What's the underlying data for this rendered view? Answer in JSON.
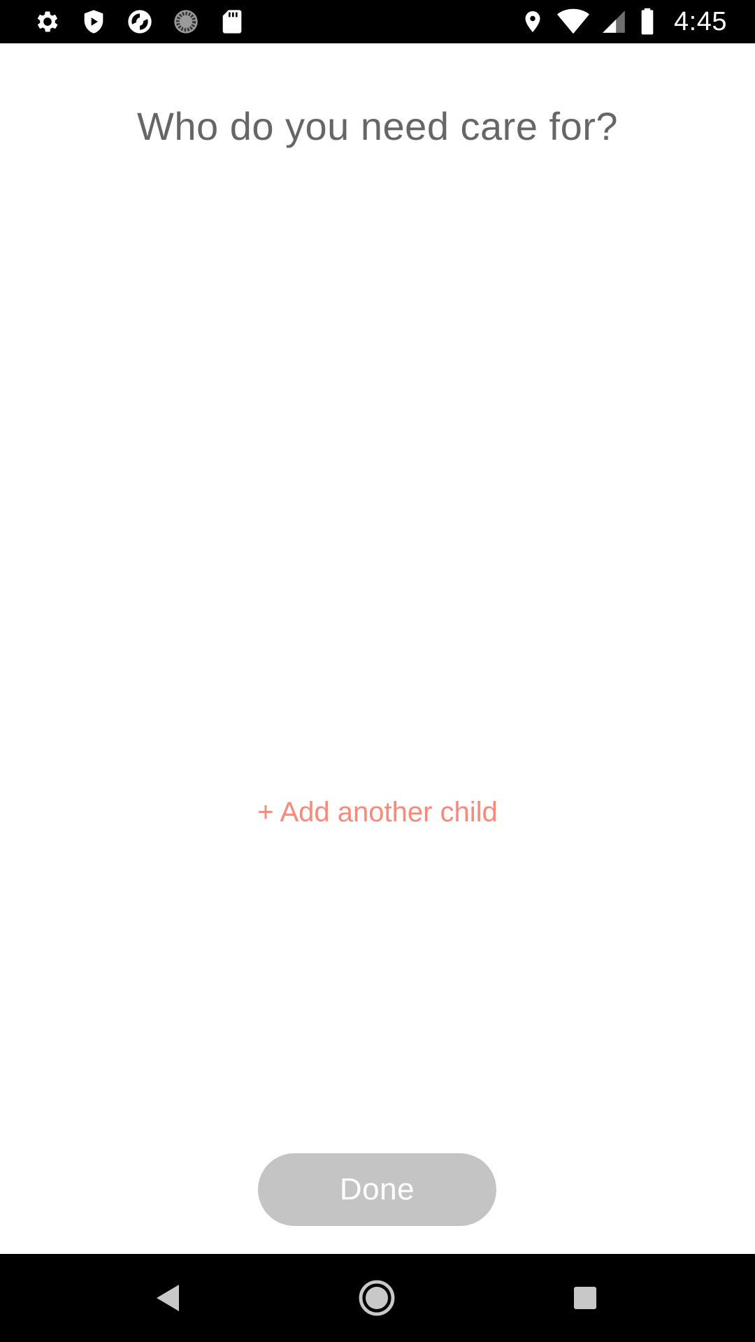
{
  "status_bar": {
    "time": "4:45",
    "left_icons": [
      "settings-gear-icon",
      "shield-icon",
      "sync-app-icon",
      "loading-circle-icon",
      "sd-card-icon"
    ],
    "right_icons": [
      "location-pin-icon",
      "wifi-icon",
      "cell-signal-icon",
      "battery-icon"
    ]
  },
  "main": {
    "title": "Who do you need care for?",
    "add_child_label": "+ Add another child",
    "done_label": "Done"
  },
  "nav_bar": {
    "icons": [
      "back-icon",
      "home-icon",
      "recents-icon"
    ]
  },
  "colors": {
    "accent": "#f88a7c",
    "title_text": "#666666",
    "disabled_button": "#c4c4c4",
    "bars": "#000000"
  }
}
